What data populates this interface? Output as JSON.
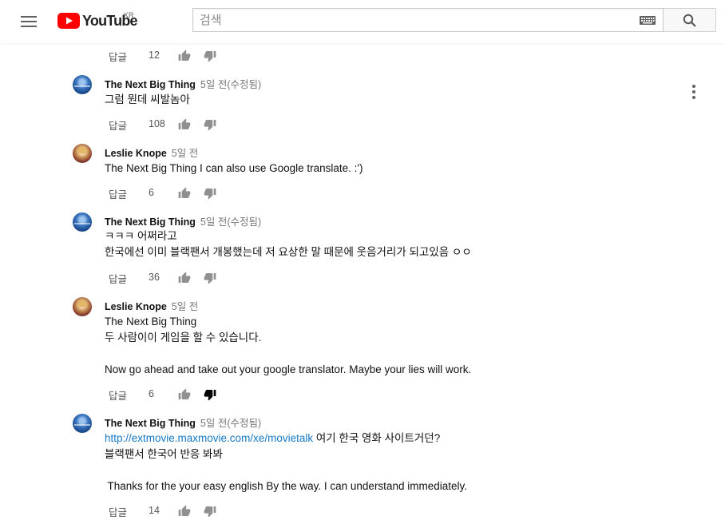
{
  "header": {
    "logo_text": "YouTube",
    "region": "KR",
    "search_placeholder": "검색"
  },
  "colors": {
    "brand_red": "#ff0000",
    "link": "#167ac6",
    "meta_gray": "#767676"
  },
  "icons": [
    "menu-icon",
    "youtube-logo-icon",
    "keyboard-icon",
    "search-icon",
    "thumb-up-icon",
    "thumb-down-icon",
    "more-vert-icon"
  ],
  "top_actions": {
    "reply": "답글",
    "likes": "12"
  },
  "comments": [
    {
      "author": "The Next Big Thing",
      "time": "5일 전(수정됨)",
      "lines": [
        "그럼 뭔데 씨발놈아"
      ],
      "reply": "답글",
      "likes": "108"
    },
    {
      "author": "Leslie Knope",
      "time": "5일 전",
      "lines": [
        "The Next Big Thing I can also use Google translate. :')"
      ],
      "reply": "답글",
      "likes": "6"
    },
    {
      "author": "The Next Big Thing",
      "time": "5일 전(수정됨)",
      "lines": [
        "ㅋㅋㅋ 어쩌라고",
        "한국에선 이미 블랙팬서 개봉했는데 저 요상한 말 때문에 웃음거리가 되고있음 ㅇㅇ"
      ],
      "reply": "답글",
      "likes": "36"
    },
    {
      "author": "Leslie Knope",
      "time": "5일 전",
      "lines": [
        "The Next Big Thing",
        "두 사람이이 게임을 할 수 있습니다.",
        "",
        "Now go ahead and take out your google translator. Maybe your lies will work."
      ],
      "reply": "답글",
      "likes": "6",
      "disliked": true
    },
    {
      "author": "The Next Big Thing",
      "time": "5일 전(수정됨)",
      "link": "http://extmovie.maxmovie.com/xe/movietalk",
      "link_suffix": " 여기 한국 영화 사이트거던?",
      "lines": [
        "블랙팬서 한국어 반응 봐봐",
        "",
        " Thanks for the your easy english By the way. I can understand immediately."
      ],
      "reply": "답글",
      "likes": "14"
    }
  ]
}
